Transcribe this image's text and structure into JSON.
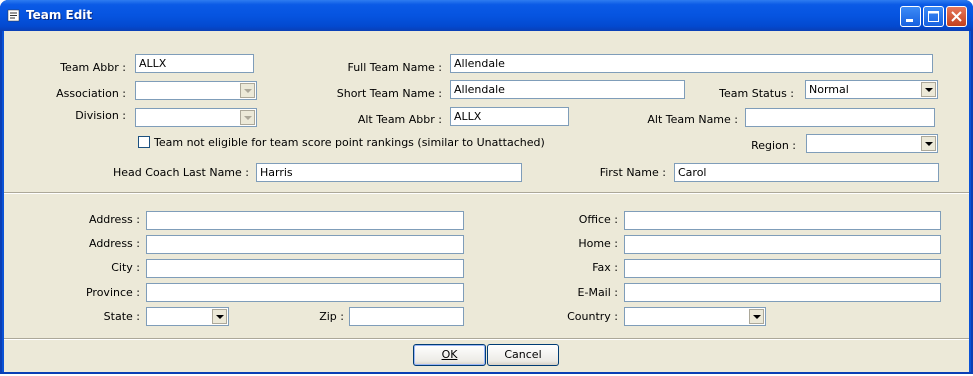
{
  "window": {
    "title": "Team Edit"
  },
  "top": {
    "team_abbr_label": "Team Abbr :",
    "team_abbr": "ALLX",
    "full_team_name_label": "Full Team Name :",
    "full_team_name": "Allendale",
    "association_label": "Association :",
    "association": "",
    "short_team_name_label": "Short Team Name :",
    "short_team_name": "Allendale",
    "team_status_label": "Team Status :",
    "team_status": "Normal",
    "division_label": "Division :",
    "division": "",
    "alt_team_abbr_label": "Alt Team Abbr :",
    "alt_team_abbr": "ALLX",
    "alt_team_name_label": "Alt Team Name :",
    "alt_team_name": "",
    "not_eligible_label": "Team not eligible for team score point rankings (similar to Unattached)",
    "region_label": "Region :",
    "region": "",
    "head_coach_last_label": "Head Coach Last Name :",
    "head_coach_last": "Harris",
    "first_name_label": "First Name :",
    "first_name": "Carol"
  },
  "contact": {
    "address1_label": "Address :",
    "address1": "",
    "address2_label": "Address :",
    "address2": "",
    "city_label": "City :",
    "city": "",
    "province_label": "Province :",
    "province": "",
    "state_label": "State :",
    "state": "",
    "zip_label": "Zip :",
    "zip": "",
    "office_label": "Office :",
    "office": "",
    "home_label": "Home :",
    "home": "",
    "fax_label": "Fax :",
    "fax": "",
    "email_label": "E-Mail :",
    "email": "",
    "country_label": "Country :",
    "country": ""
  },
  "buttons": {
    "ok": "OK",
    "cancel": "Cancel"
  }
}
